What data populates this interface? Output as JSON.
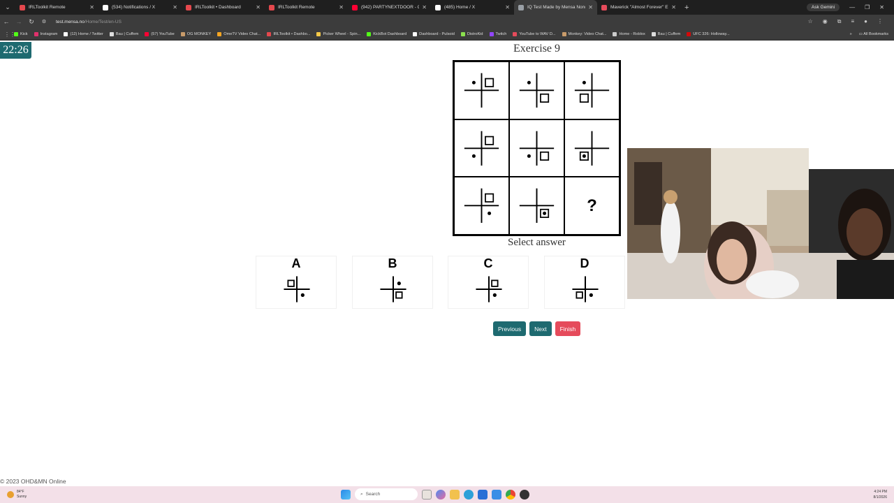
{
  "browser": {
    "tabs": [
      {
        "title": "IRLToolkit Remote",
        "color": "#e5484d",
        "active": false
      },
      {
        "title": "(534) Notifications / X",
        "color": "#ffffff",
        "active": false
      },
      {
        "title": "IRLToolkit • Dashboard",
        "color": "#e5484d",
        "active": false
      },
      {
        "title": "IRLToolkit Remote",
        "color": "#e5484d",
        "active": false
      },
      {
        "title": "(942) PARTYNEXTDOOR - Only",
        "color": "#ff0033",
        "active": false
      },
      {
        "title": "(485) Home / X",
        "color": "#ffffff",
        "active": false
      },
      {
        "title": "IQ Test Made by Mensa Norwe",
        "color": "#9aa0a6",
        "active": true
      },
      {
        "title": "Maverick \"Almost Forever\" EP",
        "color": "#e54b5b",
        "active": false
      }
    ],
    "ask_gemini": "Ask Gemini",
    "url_main": "test.mensa.no",
    "url_path": "/Home/Test/en-US",
    "bookmarks": [
      {
        "label": "Kick",
        "color": "#53fc18"
      },
      {
        "label": "Instagram",
        "color": "#e1306c"
      },
      {
        "label": "(12) Home / Twitter",
        "color": "#ffffff"
      },
      {
        "label": "Bau | Cuffem",
        "color": "#dddddd"
      },
      {
        "label": "(57) YouTube",
        "color": "#ff0033"
      },
      {
        "label": "OG MONKEY",
        "color": "#c89b6a"
      },
      {
        "label": "OmeTV Video Chat...",
        "color": "#f5a623"
      },
      {
        "label": "IRLToolkit • Dashbo...",
        "color": "#e5484d"
      },
      {
        "label": "Picker Wheel - Spin...",
        "color": "#f7c948"
      },
      {
        "label": "KickBot Dashboard",
        "color": "#53fc18"
      },
      {
        "label": "Dashboard - Pulsoid",
        "color": "#ffffff"
      },
      {
        "label": "DistroKid",
        "color": "#8be04e"
      },
      {
        "label": "Twitch",
        "color": "#9146ff"
      },
      {
        "label": "YouTube to WAV D...",
        "color": "#e54b5b"
      },
      {
        "label": "Monkey: Video Chat...",
        "color": "#c89b6a"
      },
      {
        "label": "Home - Roblox",
        "color": "#cccccc"
      },
      {
        "label": "Bau | Cuffem",
        "color": "#dddddd"
      },
      {
        "label": "UFC 326: Holloway...",
        "color": "#d20a0a"
      }
    ],
    "all_bookmarks": "All Bookmarks"
  },
  "timer": "22:26",
  "exercise_title": "Exercise 9",
  "matrix": [
    {
      "dot": "tl",
      "square": "tr"
    },
    {
      "dot": "tl",
      "square": "br"
    },
    {
      "dot": "tl",
      "square": "bl"
    },
    {
      "dot": "bl",
      "square": "tr"
    },
    {
      "dot": "bl",
      "square": "br"
    },
    {
      "dot": "inside",
      "square": "bl"
    },
    {
      "dot": "br",
      "square": "tr"
    },
    {
      "dot": "inside",
      "square": "br"
    },
    {
      "question": "?"
    }
  ],
  "select_answer": "Select answer",
  "options": [
    {
      "letter": "A",
      "dot": "br",
      "square": "tl"
    },
    {
      "letter": "B",
      "dot": "tr",
      "square": "br"
    },
    {
      "letter": "C",
      "dot": "br",
      "square": "tr"
    },
    {
      "letter": "D",
      "dot": "br",
      "square": "bl"
    }
  ],
  "buttons": {
    "previous": "Previous",
    "next": "Next",
    "finish": "Finish"
  },
  "footer": "© 2023 OHD&MN Online",
  "taskbar": {
    "weather_temp": "84°F",
    "weather_text": "Sunny",
    "search": "Search",
    "time": "4:24 PM",
    "date": "8/1/2026"
  },
  "colors": {
    "teal": "#1e6a70",
    "finish_red": "#e54b5b"
  }
}
